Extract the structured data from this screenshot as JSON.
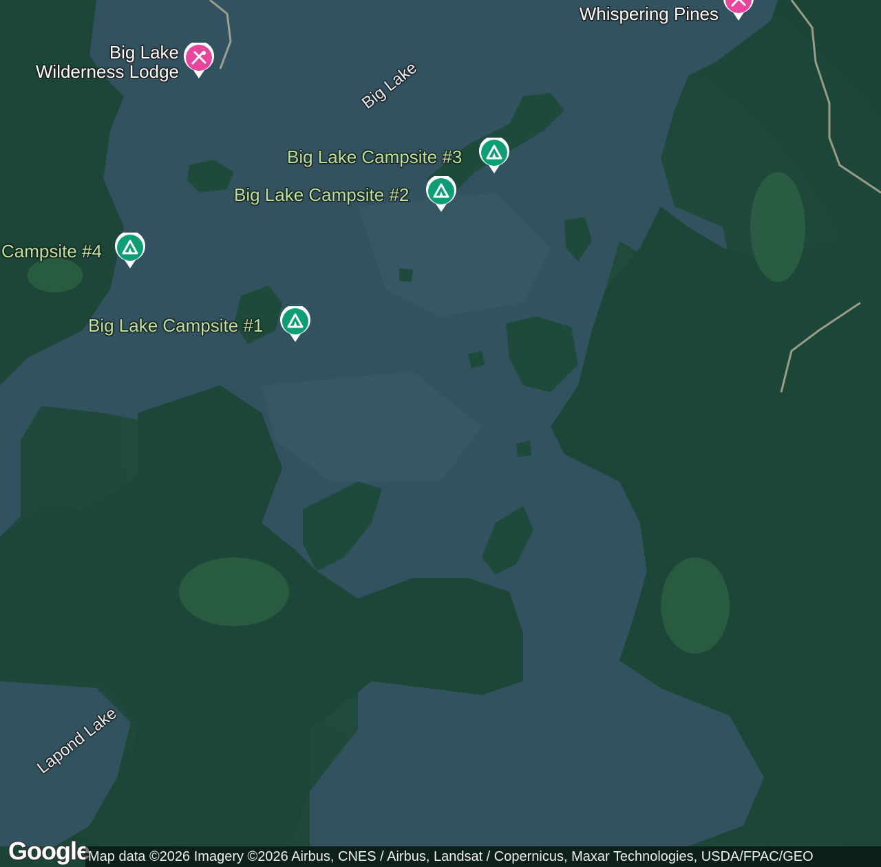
{
  "map": {
    "colors": {
      "water": "#33525f",
      "forest": "#1f4a3b",
      "campsite_pin": "#0f9d75",
      "lodge_pin": "#e8459d"
    },
    "campsites": [
      {
        "label": "Big Lake Campsite #1",
        "icon": "campsite-tent-icon"
      },
      {
        "label": "Big Lake Campsite #2",
        "icon": "campsite-tent-icon"
      },
      {
        "label": "Big Lake Campsite #3",
        "icon": "campsite-tent-icon"
      },
      {
        "label": "Campsite #4",
        "icon": "campsite-tent-icon"
      }
    ],
    "lodges": [
      {
        "line1": "Big Lake",
        "line2": "Wilderness Lodge",
        "icon": "lodge-icon"
      },
      {
        "line1": "Whispering Pines",
        "icon": "lodge-icon"
      }
    ],
    "water_labels": [
      "Big Lake",
      "Lapond Lake"
    ],
    "logo": "Google",
    "attribution": "Map data ©2026 Imagery ©2026 Airbus, CNES / Airbus, Landsat / Copernicus, Maxar Technologies, USDA/FPAC/GEO"
  }
}
